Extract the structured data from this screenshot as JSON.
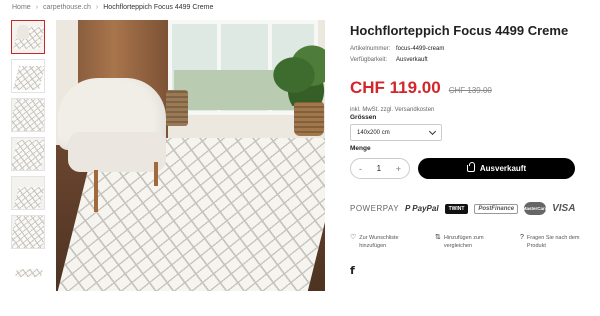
{
  "breadcrumb": [
    "Home",
    "carpethouse.ch",
    "Hochflorteppich Focus 4499 Creme"
  ],
  "product": {
    "title": "Hochflorteppich Focus 4499 Creme",
    "meta": [
      {
        "key": "Artikelnummer:",
        "value": "focus-4499-cream"
      },
      {
        "key": "Verfügbarkeit:",
        "value": "Ausverkauft"
      }
    ],
    "price_now": "CHF 119.00",
    "price_old": "CHF 139.00",
    "vat_note": "inkl. MwSt. zzgl. Versandkosten",
    "size_label": "Grössen",
    "size_value": "140x200 cm",
    "qty_label": "Menge",
    "qty_value": "1",
    "qty_minus": "-",
    "qty_plus": "+",
    "cta_label": "Ausverkauft"
  },
  "payments": [
    "POWERPAY",
    "P PayPal",
    "TWINT",
    "PostFinance",
    "MasterCard",
    "VISA"
  ],
  "actions": [
    {
      "icon": "heart-icon",
      "glyph": "♡",
      "label": "Zur Wunschliste hinzufügen"
    },
    {
      "icon": "compare-icon",
      "glyph": "⇅",
      "label": "Hinzufügen zum vergleichen"
    },
    {
      "icon": "question-icon",
      "glyph": "?",
      "label": "Fragen Sie nach dem Produkt"
    }
  ],
  "social": {
    "facebook": "f"
  },
  "colors": {
    "accent": "#d3262b",
    "cta": "#000000",
    "active_thumb_border": "#c62828"
  }
}
